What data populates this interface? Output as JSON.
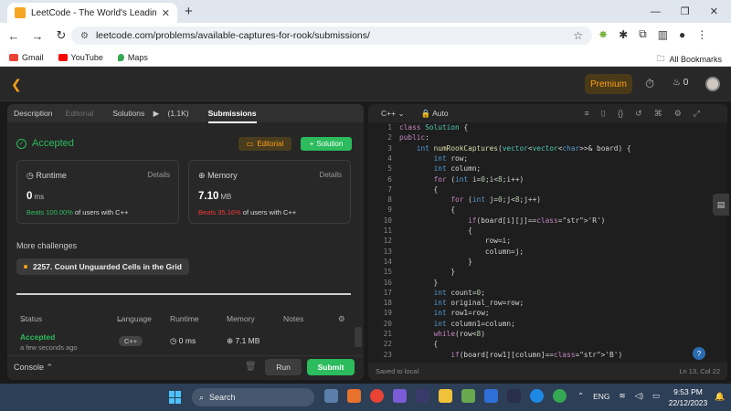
{
  "browser": {
    "tab_title": "LeetCode - The World's Leadin",
    "url": "leetcode.com/problems/available-captures-for-rook/submissions/",
    "bookmarks": [
      "Gmail",
      "YouTube",
      "Maps"
    ],
    "all_bookmarks": "All Bookmarks"
  },
  "leetcode": {
    "premium": "Premium",
    "streak": "0"
  },
  "left": {
    "tabs": [
      "Description",
      "Editorial",
      "Solutions",
      "(1.1K)",
      "Submissions"
    ],
    "status": "Accepted",
    "editorial_btn": "Editorial",
    "solution_btn": "Solution",
    "runtime": {
      "label": "Runtime",
      "details": "Details",
      "value": "0",
      "unit": "ms",
      "beats_pct": "Beats 100.00%",
      "beats_rest": "of users with C++"
    },
    "memory": {
      "label": "Memory",
      "details": "Details",
      "value": "7.10",
      "unit": "MB",
      "beats_pct": "Beats 35.16%",
      "beats_rest": "of users with C++"
    },
    "more_challenges": "More challenges",
    "challenge": "2257. Count Unguarded Cells in the Grid",
    "table_headers": [
      "Status",
      "Language",
      "Runtime",
      "Memory",
      "Notes"
    ],
    "row": {
      "status": "Accepted",
      "time": "a few seconds ago",
      "lang": "C++",
      "runtime": "0 ms",
      "memory": "7.1 MB"
    },
    "console": "Console",
    "run": "Run",
    "submit": "Submit"
  },
  "editor": {
    "language": "C++",
    "mode": "Auto",
    "saved": "Saved to local",
    "position": "Ln 13, Col 22",
    "lines": [
      "class Solution {",
      "public:",
      "    int numRookCaptures(vector<vector<char>>& board) {",
      "        int row;",
      "        int column;",
      "        for (int i=0;i<8;i++)",
      "        {",
      "            for (int j=0;j<8;j++)",
      "            {",
      "                if(board[i][j]=='R')",
      "                {",
      "                    row=i;",
      "                    column=j;",
      "                }",
      "            }",
      "        }",
      "        int count=0;",
      "        int original_row=row;",
      "        int row1=row;",
      "        int column1=column;",
      "        while(row<8)",
      "        {",
      "            if(board[row1][column]=='B')"
    ]
  },
  "taskbar": {
    "search": "Search",
    "lang": "ENG",
    "time": "9:53 PM",
    "date": "22/12/2023"
  },
  "colors": {
    "accent_green": "#2cbb5d",
    "accent_orange": "#ffa116",
    "beats_red": "#f63636"
  }
}
